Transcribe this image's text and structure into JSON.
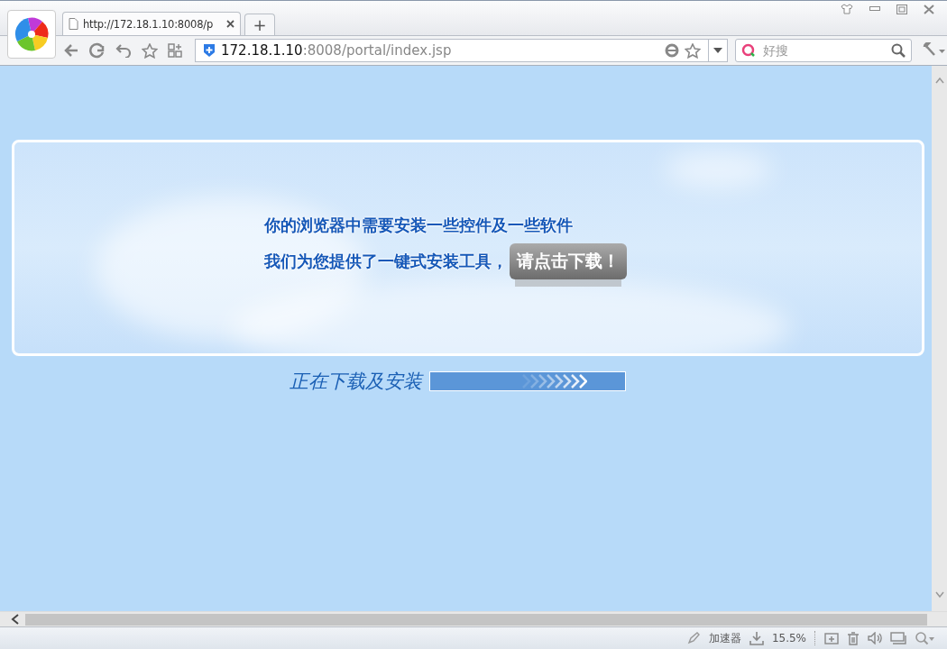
{
  "browser": {
    "tab": {
      "title": "http://172.18.1.10:8008/p"
    },
    "new_tab": "+",
    "address": {
      "host": "172.18.1.10",
      "path": ":8008/portal/index.jsp"
    },
    "search": {
      "placeholder": "好搜"
    }
  },
  "banner": {
    "lines": [
      "你的浏览器中需要安装一些控件及一些软件",
      "我们为您提供了一键式安装工具，"
    ],
    "button": "请点击下载！"
  },
  "progress": {
    "label": "正在下载及安装"
  },
  "status_bar": {
    "accelerator": "加速器",
    "download": "15.5%"
  }
}
